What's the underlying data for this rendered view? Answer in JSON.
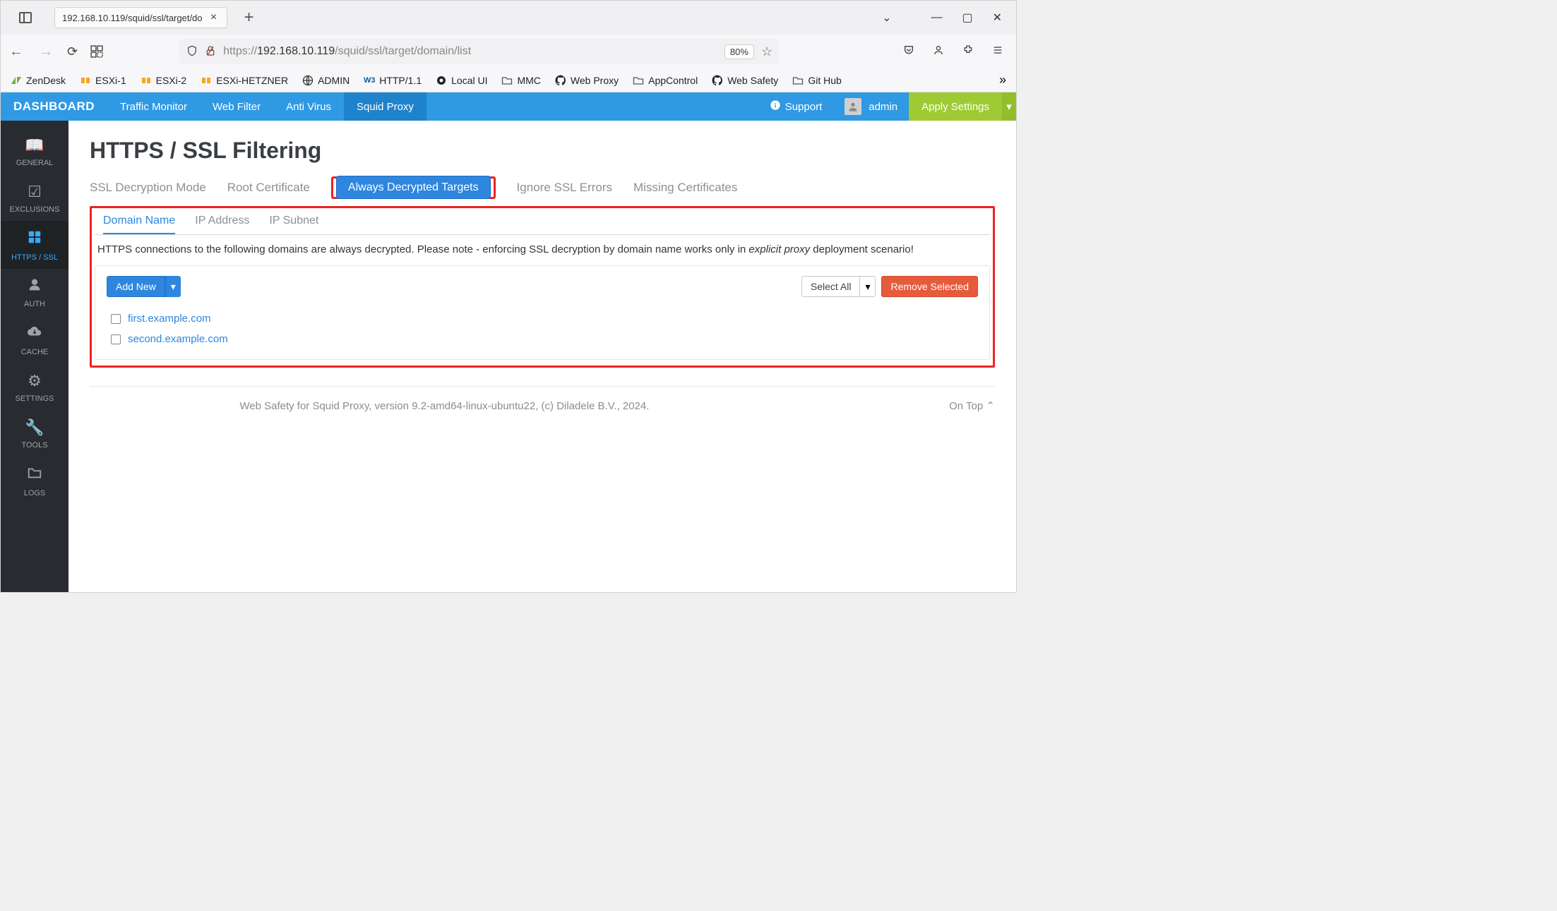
{
  "browser": {
    "tab_title": "192.168.10.119/squid/ssl/target/do",
    "url_prefix": "https://",
    "url_host": "192.168.10.119",
    "url_path": "/squid/ssl/target/domain/list",
    "zoom": "80%"
  },
  "bookmarks": [
    {
      "label": "ZenDesk",
      "kind": "zendesk"
    },
    {
      "label": "ESXi-1",
      "kind": "vmware"
    },
    {
      "label": "ESXi-2",
      "kind": "vmware"
    },
    {
      "label": "ESXi-HETZNER",
      "kind": "vmware"
    },
    {
      "label": "ADMIN",
      "kind": "globe"
    },
    {
      "label": "HTTP/1.1",
      "kind": "w3"
    },
    {
      "label": "Local UI",
      "kind": "dot"
    },
    {
      "label": "MMC",
      "kind": "folder"
    },
    {
      "label": "Web Proxy",
      "kind": "github"
    },
    {
      "label": "AppControl",
      "kind": "folder"
    },
    {
      "label": "Web Safety",
      "kind": "github"
    },
    {
      "label": "Git Hub",
      "kind": "folder"
    }
  ],
  "topnav": {
    "brand": "DASHBOARD",
    "items": [
      "Traffic Monitor",
      "Web Filter",
      "Anti Virus",
      "Squid Proxy"
    ],
    "active": "Squid Proxy",
    "support": "Support",
    "user": "admin",
    "apply": "Apply Settings"
  },
  "rail": [
    {
      "label": "GENERAL",
      "icon": "book"
    },
    {
      "label": "EXCLUSIONS",
      "icon": "check"
    },
    {
      "label": "HTTPS / SSL",
      "icon": "grid",
      "active": true
    },
    {
      "label": "AUTH",
      "icon": "user"
    },
    {
      "label": "CACHE",
      "icon": "cloud"
    },
    {
      "label": "SETTINGS",
      "icon": "gear"
    },
    {
      "label": "TOOLS",
      "icon": "wrench"
    },
    {
      "label": "LOGS",
      "icon": "folder"
    }
  ],
  "page": {
    "title": "HTTPS / SSL Filtering",
    "subtabs": [
      "SSL Decryption Mode",
      "Root Certificate",
      "Always Decrypted Targets",
      "Ignore SSL Errors",
      "Missing Certificates"
    ],
    "active_subtab": "Always Decrypted Targets",
    "minitabs": [
      "Domain Name",
      "IP Address",
      "IP Subnet"
    ],
    "active_minitab": "Domain Name",
    "description_pre": "HTTPS connections to the following domains are always decrypted. Please note - enforcing SSL decryption by domain name works only in ",
    "description_em": "explicit proxy",
    "description_post": " deployment scenario!",
    "add_new": "Add New",
    "select_all": "Select All",
    "remove_selected": "Remove Selected",
    "domains": [
      "first.example.com",
      "second.example.com"
    ]
  },
  "footer": {
    "text": "Web Safety for Squid Proxy, version 9.2-amd64-linux-ubuntu22, (c) Diladele B.V., 2024.",
    "ontop": "On Top"
  }
}
